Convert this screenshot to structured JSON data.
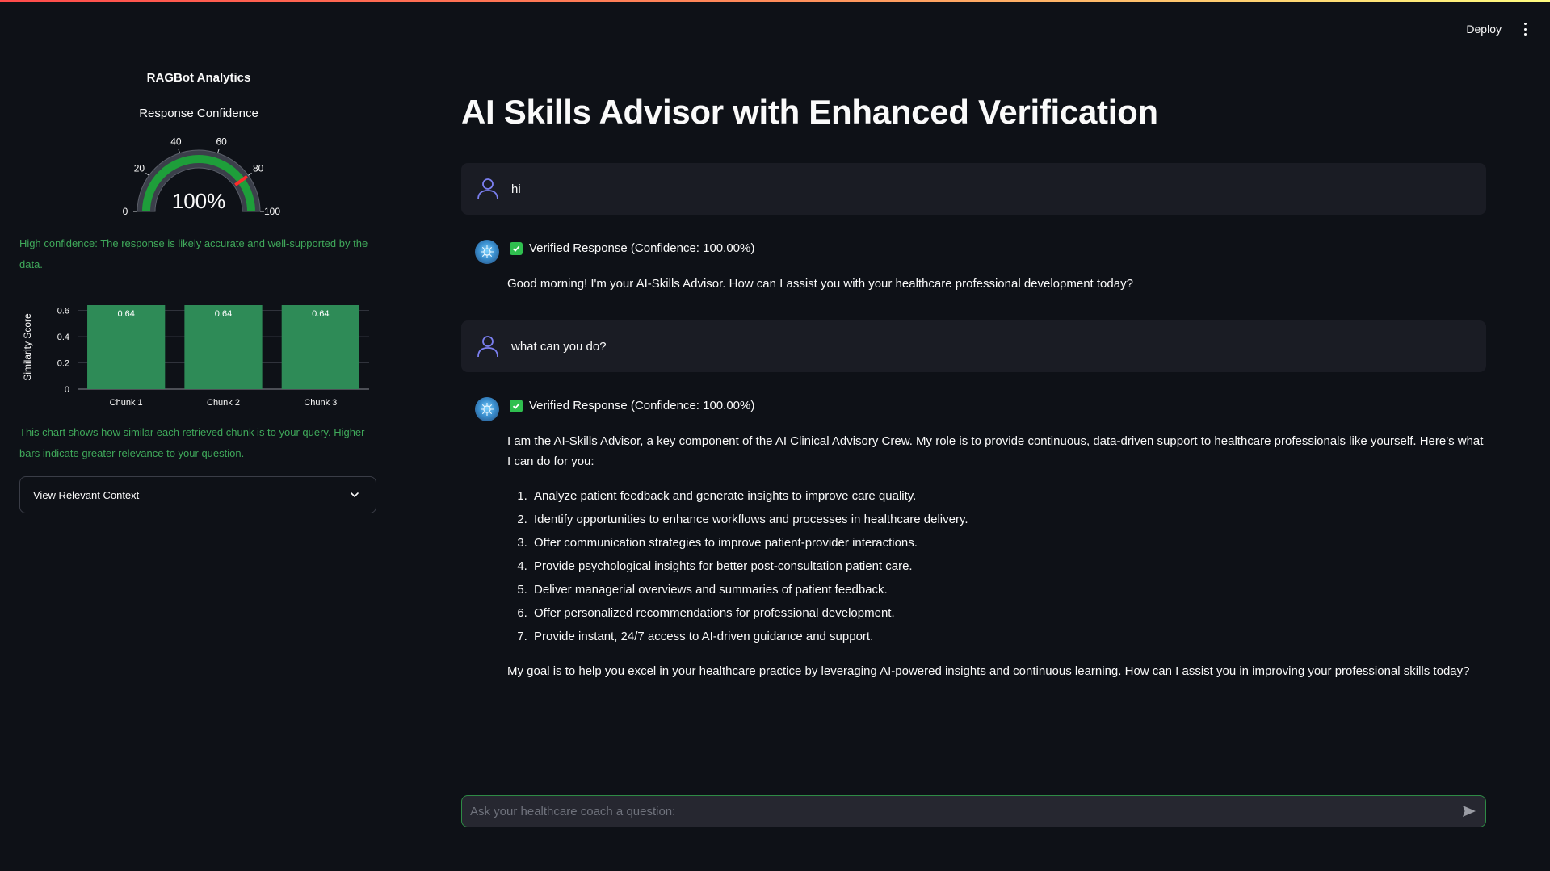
{
  "header": {
    "deploy_label": "Deploy",
    "menu_icon": "vertical-dots-icon"
  },
  "sidebar": {
    "title": "RAGBot Analytics",
    "gauge": {
      "title": "Response Confidence",
      "value": 100,
      "display": "100%",
      "min": 0,
      "max": 100,
      "ticks": [
        0,
        20,
        40,
        60,
        80,
        100
      ],
      "threshold": 80,
      "bar_color": "#1e9e3a",
      "threshold_color": "#ff2b2b"
    },
    "confidence_note": "High confidence: The response is likely accurate and well-supported by the data.",
    "chart_note": "This chart shows how similar each retrieved chunk is to your query. Higher bars indicate greater relevance to your question.",
    "expander_label": "View Relevant Context"
  },
  "chart_data": [
    {
      "type": "gauge",
      "title": "Response Confidence",
      "value": 100,
      "range": [
        0,
        100
      ],
      "ticks": [
        0,
        20,
        40,
        60,
        80,
        100
      ],
      "threshold": 80
    },
    {
      "type": "bar",
      "categories": [
        "Chunk 1",
        "Chunk 2",
        "Chunk 3"
      ],
      "values": [
        0.64,
        0.64,
        0.64
      ],
      "data_labels": [
        "0.64",
        "0.64",
        "0.64"
      ],
      "ylabel": "Similarity Score",
      "xlabel": "",
      "ylim": [
        0,
        0.64
      ],
      "yticks": [
        "0",
        "0.2",
        "0.4",
        "0.6"
      ],
      "grid": true,
      "bar_color": "#2e8b57"
    }
  ],
  "main": {
    "title": "AI Skills Advisor with Enhanced Verification",
    "messages": [
      {
        "role": "user",
        "text": "hi"
      },
      {
        "role": "assistant",
        "verified": "Verified Response (Confidence: 100.00%)",
        "text": "Good morning! I'm your AI-Skills Advisor. How can I assist you with your healthcare professional development today?"
      },
      {
        "role": "user",
        "text": "what can you do?"
      },
      {
        "role": "assistant",
        "verified": "Verified Response (Confidence: 100.00%)",
        "intro": "I am the AI-Skills Advisor, a key component of the AI Clinical Advisory Crew. My role is to provide continuous, data-driven support to healthcare professionals like yourself. Here's what I can do for you:",
        "items": [
          "Analyze patient feedback and generate insights to improve care quality.",
          "Identify opportunities to enhance workflows and processes in healthcare delivery.",
          "Offer communication strategies to improve patient-provider interactions.",
          "Provide psychological insights for better post-consultation patient care.",
          "Deliver managerial overviews and summaries of patient feedback.",
          "Offer personalized recommendations for professional development.",
          "Provide instant, 24/7 access to AI-driven guidance and support."
        ],
        "outro": "My goal is to help you excel in your healthcare practice by leveraging AI-powered insights and continuous learning. How can I assist you in improving your professional skills today?"
      }
    ],
    "chat_input": {
      "placeholder": "Ask your healthcare coach a question:",
      "value": ""
    }
  }
}
